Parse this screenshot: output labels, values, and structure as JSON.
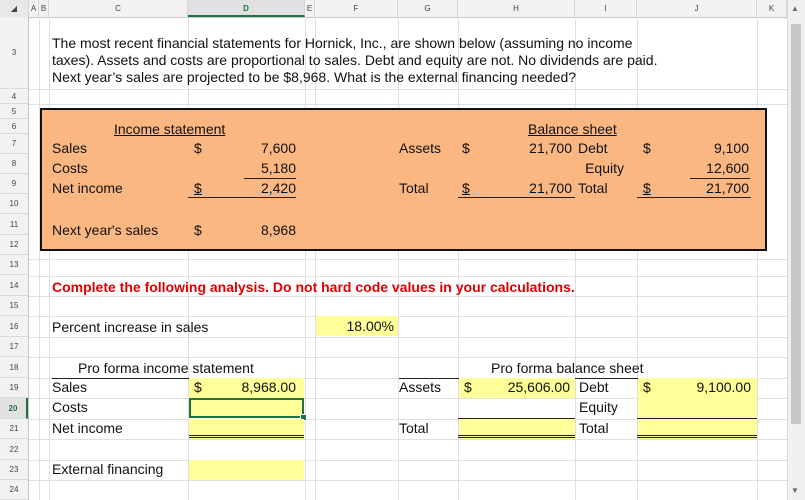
{
  "columns": [
    "A",
    "B",
    "C",
    "D",
    "E",
    "F",
    "G",
    "H",
    "I",
    "J",
    "K"
  ],
  "rows": [
    "3",
    "4",
    "5",
    "6",
    "7",
    "8",
    "9",
    "10",
    "11",
    "12",
    "13",
    "14",
    "15",
    "16",
    "17",
    "18",
    "19",
    "20",
    "21",
    "22",
    "23",
    "24"
  ],
  "problem": {
    "line1": "The most recent financial statements for Hornick, Inc., are shown below (assuming no income",
    "line2": "taxes). Assets and costs are proportional to sales. Debt and equity are not. No dividends are paid.",
    "line3": "Next year’s sales are projected to be $8,968. What is the external financing needed?"
  },
  "income": {
    "title": "Income statement",
    "sales_label": "Sales",
    "sales_cur": "$",
    "sales_val": "7,600",
    "costs_label": "Costs",
    "costs_val": "5,180",
    "ni_label": "Net income",
    "ni_cur": "$",
    "ni_val": "2,420"
  },
  "balance": {
    "title": "Balance sheet",
    "assets_label": "Assets",
    "assets_cur": "$",
    "assets_val": "21,700",
    "debt_label": "Debt",
    "debt_cur": "$",
    "debt_val": "9,100",
    "equity_label": "Equity",
    "equity_val": "12,600",
    "total_label": "Total",
    "total_cur": "$",
    "total_val": "21,700",
    "total2_label": "Total",
    "total2_cur": "$",
    "total2_val": "21,700"
  },
  "next_sales": {
    "label": "Next year's sales",
    "cur": "$",
    "val": "8,968"
  },
  "instruction": "Complete the following analysis. Do not hard code values in your calculations.",
  "pct": {
    "label": "Percent increase in sales",
    "val": "18.00%"
  },
  "pf_income": {
    "title": "Pro forma income statement",
    "sales_label": "Sales",
    "sales_cur": "$",
    "sales_val": "8,968.00",
    "costs_label": "Costs",
    "ni_label": "Net income"
  },
  "pf_balance": {
    "title": "Pro forma balance sheet",
    "assets_label": "Assets",
    "assets_cur": "$",
    "assets_val": "25,606.00",
    "debt_label": "Debt",
    "debt_cur": "$",
    "debt_val": "9,100.00",
    "equity_label": "Equity",
    "total_label": "Total",
    "total2_label": "Total"
  },
  "ext_fin": {
    "label": "External financing"
  },
  "colors": {
    "box_fill": "#fbb782",
    "yellow": "#ffff99",
    "red": "#e00000",
    "accent": "#217346"
  }
}
